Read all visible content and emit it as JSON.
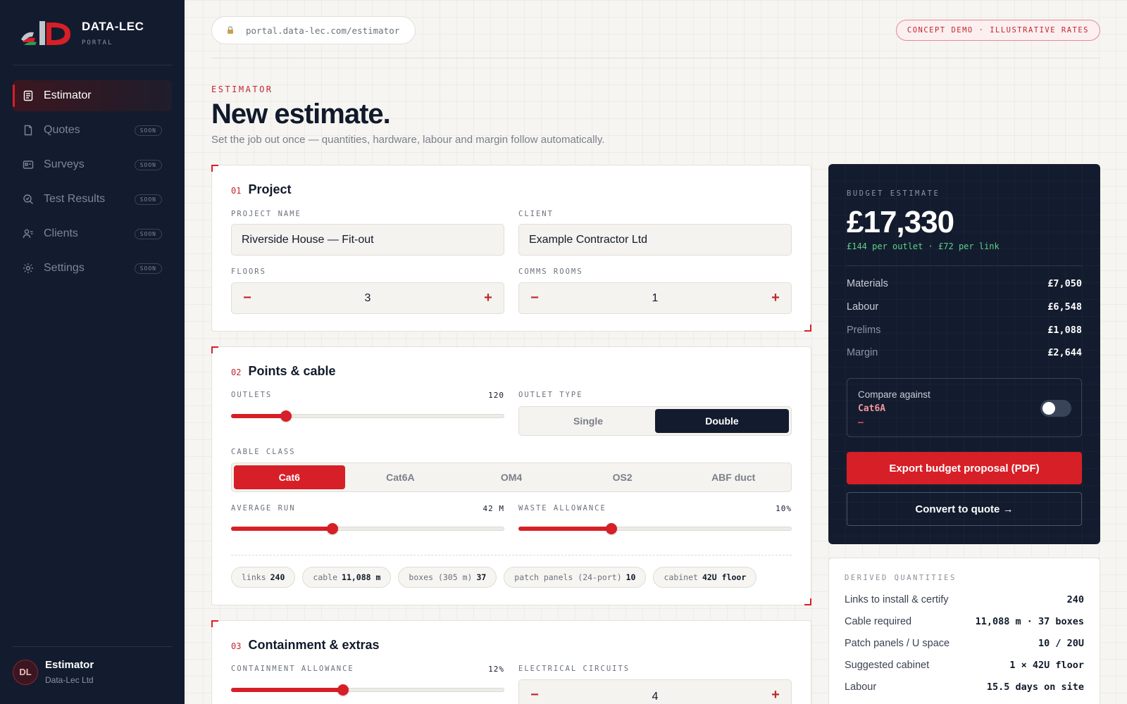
{
  "brand": {
    "name": "DATA-LEC",
    "sub": "PORTAL"
  },
  "colors": {
    "accent": "#d71f27",
    "navy": "#131c2e",
    "green": "#5fd08a"
  },
  "sidebar": {
    "items": [
      {
        "label": "Estimator",
        "icon": "document-icon",
        "active": true
      },
      {
        "label": "Quotes",
        "icon": "file-icon",
        "badge": "SOON"
      },
      {
        "label": "Surveys",
        "icon": "card-icon",
        "badge": "SOON"
      },
      {
        "label": "Test Results",
        "icon": "magnifier-icon",
        "badge": "SOON"
      },
      {
        "label": "Clients",
        "icon": "users-icon",
        "badge": "SOON"
      },
      {
        "label": "Settings",
        "icon": "gear-icon",
        "badge": "SOON"
      }
    ],
    "user": {
      "initials": "DL",
      "name": "Estimator",
      "org": "Data-Lec Ltd"
    }
  },
  "topbar": {
    "url": "portal.data-lec.com/estimator",
    "badge": "CONCEPT DEMO · ILLUSTRATIVE RATES"
  },
  "header": {
    "eyebrow": "ESTIMATOR",
    "title": "New estimate.",
    "subtitle": "Set the job out once — quantities, hardware, labour and margin follow automatically."
  },
  "project": {
    "num": "01",
    "title": "Project",
    "name_label": "PROJECT NAME",
    "name_value": "Riverside House — Fit-out",
    "client_label": "CLIENT",
    "client_value": "Example Contractor Ltd",
    "floors_label": "FLOORS",
    "floors_value": "3",
    "rooms_label": "COMMS ROOMS",
    "rooms_value": "1",
    "minus": "−",
    "plus": "+"
  },
  "points": {
    "num": "02",
    "title": "Points & cable",
    "outlets_label": "OUTLETS",
    "outlets_value": "120",
    "outlets_fraction": 0.2,
    "outlet_type_label": "OUTLET TYPE",
    "outlet_types": [
      "Single",
      "Double"
    ],
    "outlet_type_selected": "Double",
    "cable_class_label": "CABLE CLASS",
    "cable_classes": [
      "Cat6",
      "Cat6A",
      "OM4",
      "OS2",
      "ABF duct"
    ],
    "cable_class_selected": "Cat6",
    "avg_run_label": "AVERAGE RUN",
    "avg_run_value": "42 M",
    "avg_run_fraction": 0.37,
    "waste_label": "WASTE ALLOWANCE",
    "waste_value": "10%",
    "waste_fraction": 0.34,
    "chips": [
      {
        "k": "links",
        "v": "240"
      },
      {
        "k": "cable",
        "v": "11,088 m"
      },
      {
        "k": "boxes (305 m)",
        "v": "37"
      },
      {
        "k": "patch panels (24-port)",
        "v": "10"
      },
      {
        "k": "cabinet",
        "v": "42U floor"
      }
    ]
  },
  "containment": {
    "num": "03",
    "title": "Containment & extras",
    "allowance_label": "CONTAINMENT ALLOWANCE",
    "allowance_value": "12%",
    "allowance_fraction": 0.41,
    "circuits_label": "ELECTRICAL CIRCUITS",
    "circuits_value": "4"
  },
  "budget": {
    "label": "BUDGET ESTIMATE",
    "total": "£17,330",
    "per": "£144 per outlet · £72 per link",
    "rows": [
      {
        "k": "Materials",
        "v": "£7,050"
      },
      {
        "k": "Labour",
        "v": "£6,548"
      },
      {
        "k": "Prelims",
        "v": "£1,088"
      },
      {
        "k": "Margin",
        "v": "£2,644"
      }
    ],
    "compare_label": "Compare against",
    "compare_value": "Cat6A",
    "compare_delta": "—",
    "export_label": "Export budget proposal (PDF)",
    "convert_label": "Convert to quote →"
  },
  "derived": {
    "label": "DERIVED QUANTITIES",
    "rows": [
      {
        "k": "Links to install & certify",
        "v": "240"
      },
      {
        "k": "Cable required",
        "v": "11,088 m · 37 boxes"
      },
      {
        "k": "Patch panels / U space",
        "v": "10 / 20U"
      },
      {
        "k": "Suggested cabinet",
        "v": "1 × 42U floor"
      },
      {
        "k": "Labour",
        "v": "15.5 days on site"
      }
    ]
  }
}
